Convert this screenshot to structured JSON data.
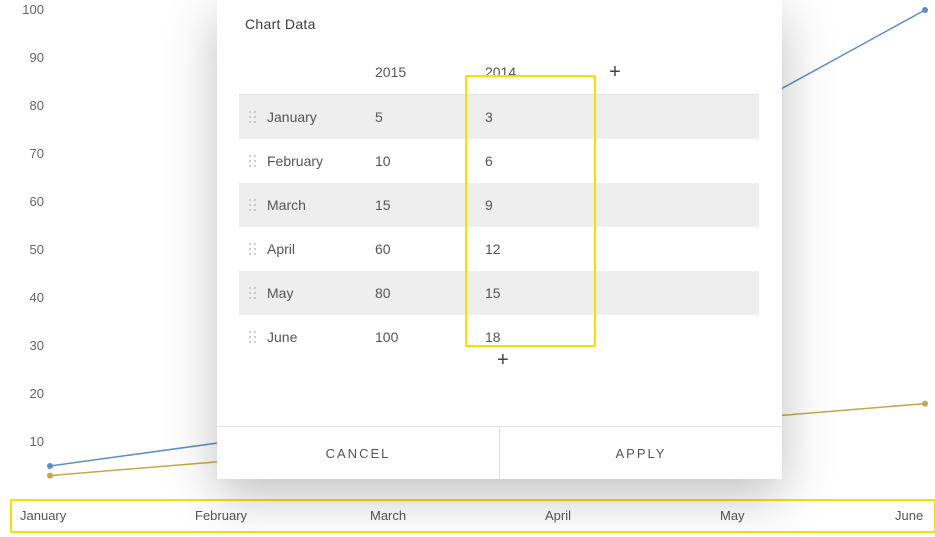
{
  "modal": {
    "title": "Chart Data",
    "columns": [
      "2015",
      "2014"
    ],
    "rows": [
      {
        "month": "January",
        "2015": "5",
        "2014": "3"
      },
      {
        "month": "February",
        "2015": "10",
        "2014": "6"
      },
      {
        "month": "March",
        "2015": "15",
        "2014": "9"
      },
      {
        "month": "April",
        "2015": "60",
        "2014": "12"
      },
      {
        "month": "May",
        "2015": "80",
        "2014": "15"
      },
      {
        "month": "June",
        "2015": "100",
        "2014": "18"
      }
    ],
    "add_row_icon": "+",
    "add_col_icon": "+",
    "cancel_label": "CANCEL",
    "apply_label": "APPLY"
  },
  "chart_data": {
    "type": "line",
    "categories": [
      "January",
      "February",
      "March",
      "April",
      "May",
      "June"
    ],
    "series": [
      {
        "name": "2015",
        "values": [
          5,
          10,
          15,
          60,
          80,
          100
        ],
        "color": "#5b8fc7"
      },
      {
        "name": "2014",
        "values": [
          3,
          6,
          9,
          12,
          15,
          18
        ],
        "color": "#c4a84a"
      }
    ],
    "title": "",
    "xlabel": "",
    "ylabel": "",
    "ylim": [
      0,
      100
    ],
    "y_ticks": [
      10,
      20,
      30,
      40,
      50,
      60,
      70,
      80,
      90,
      100
    ]
  }
}
